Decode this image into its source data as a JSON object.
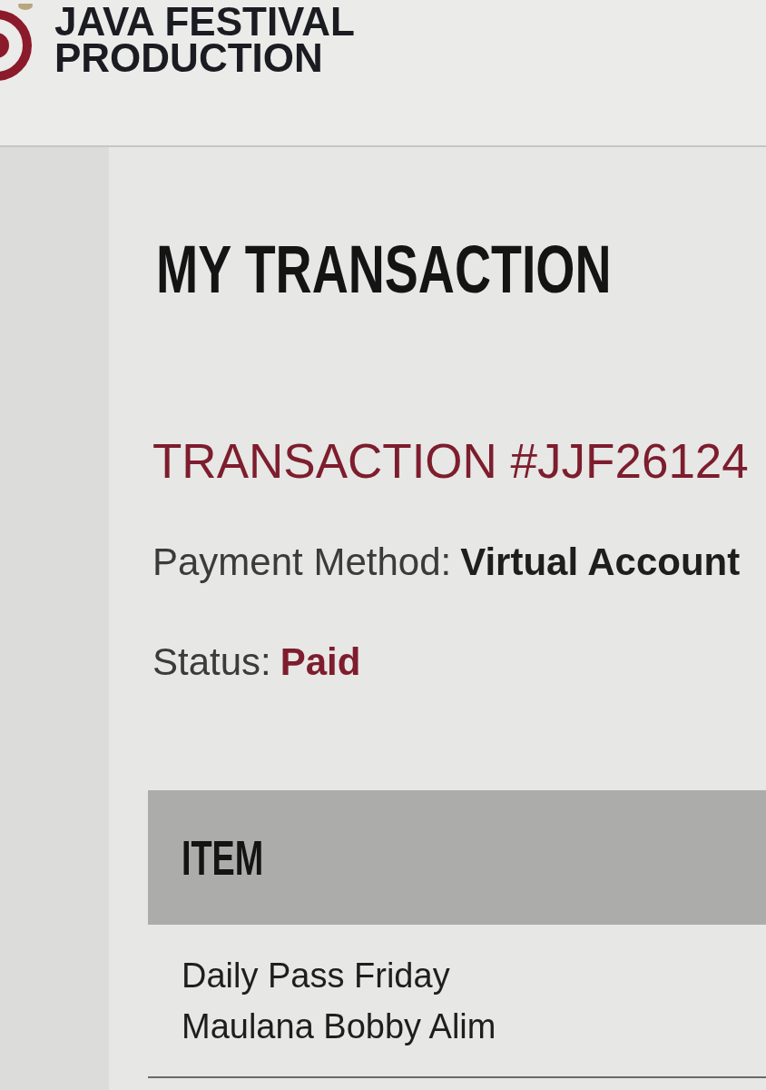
{
  "logo": {
    "line_1": "JAVA FESTIVAL",
    "line_2": "PRODUCTION"
  },
  "page_title": "MY TRANSACTION",
  "transaction": {
    "title": "TRANSACTION #JJF26124",
    "details": [
      {
        "label": "Payment Method:",
        "value": "Virtual Account",
        "kind": "plain"
      },
      {
        "label": "Status:",
        "value": "Paid",
        "kind": "status"
      }
    ]
  },
  "table": {
    "columns": [
      "ITEM"
    ],
    "rows": [
      {
        "item": "Daily Pass Friday",
        "detail": "Maulana Bobby Alim"
      }
    ]
  }
}
